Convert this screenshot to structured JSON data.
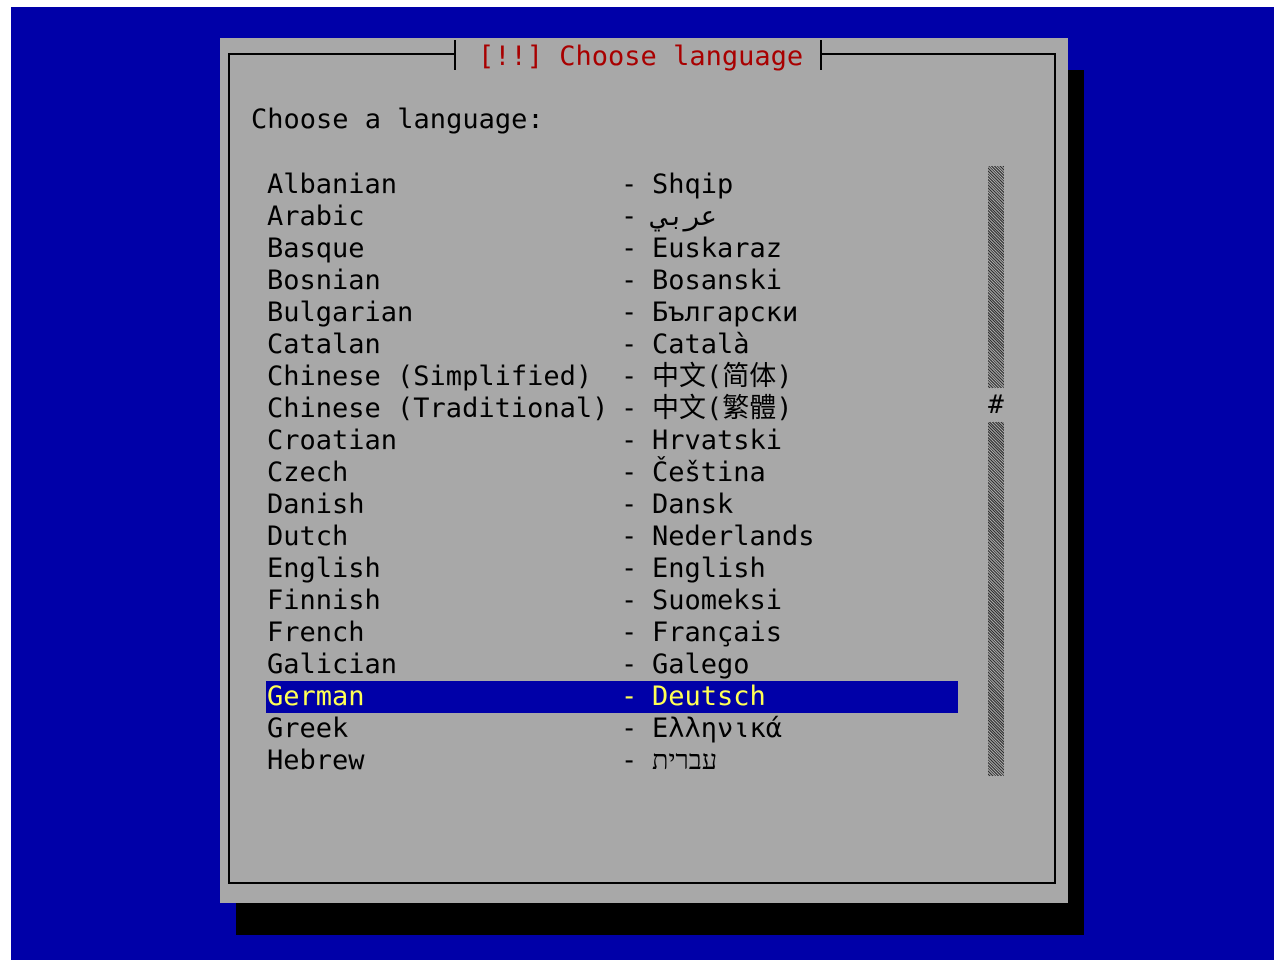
{
  "dialog": {
    "title": "[!!] Choose language",
    "prompt": "Choose a language:"
  },
  "languages": [
    {
      "english": "Albanian",
      "native": "Shqip"
    },
    {
      "english": "Arabic",
      "native": "عربي"
    },
    {
      "english": "Basque",
      "native": "Euskaraz"
    },
    {
      "english": "Bosnian",
      "native": "Bosanski"
    },
    {
      "english": "Bulgarian",
      "native": "Български"
    },
    {
      "english": "Catalan",
      "native": "Català"
    },
    {
      "english": "Chinese (Simplified)",
      "native": "中文(简体)"
    },
    {
      "english": "Chinese (Traditional)",
      "native": "中文(繁體)"
    },
    {
      "english": "Croatian",
      "native": "Hrvatski"
    },
    {
      "english": "Czech",
      "native": "Čeština"
    },
    {
      "english": "Danish",
      "native": "Dansk"
    },
    {
      "english": "Dutch",
      "native": "Nederlands"
    },
    {
      "english": "English",
      "native": "English"
    },
    {
      "english": "Finnish",
      "native": "Suomeksi"
    },
    {
      "english": "French",
      "native": "Français"
    },
    {
      "english": "Galician",
      "native": "Galego"
    },
    {
      "english": "German",
      "native": "Deutsch",
      "selected": true
    },
    {
      "english": "Greek",
      "native": "Ελληνικά"
    },
    {
      "english": "Hebrew",
      "native": "עברית"
    }
  ],
  "separator": "-",
  "scrollbar": {
    "thumb": "#"
  },
  "colors": {
    "background": "#0000a8",
    "dialog": "#a8a8a8",
    "title": "#a80000",
    "selected_bg": "#0000a8",
    "selected_text": "#ffff55",
    "shadow": "#000000"
  }
}
